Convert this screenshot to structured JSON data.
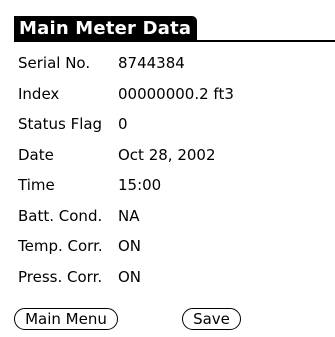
{
  "title": "Main Meter Data",
  "fields": [
    {
      "label": "Serial No.",
      "value": "8744384"
    },
    {
      "label": "Index",
      "value": "00000000.2 ft3"
    },
    {
      "label": "Status Flag",
      "value": "0"
    },
    {
      "label": "Date",
      "value": "Oct 28, 2002"
    },
    {
      "label": "Time",
      "value": "15:00"
    },
    {
      "label": "Batt. Cond.",
      "value": "NA"
    },
    {
      "label": "Temp. Corr.",
      "value": "ON"
    },
    {
      "label": "Press. Corr.",
      "value": "ON"
    }
  ],
  "buttons": {
    "main_menu": "Main Menu",
    "save": "Save"
  }
}
